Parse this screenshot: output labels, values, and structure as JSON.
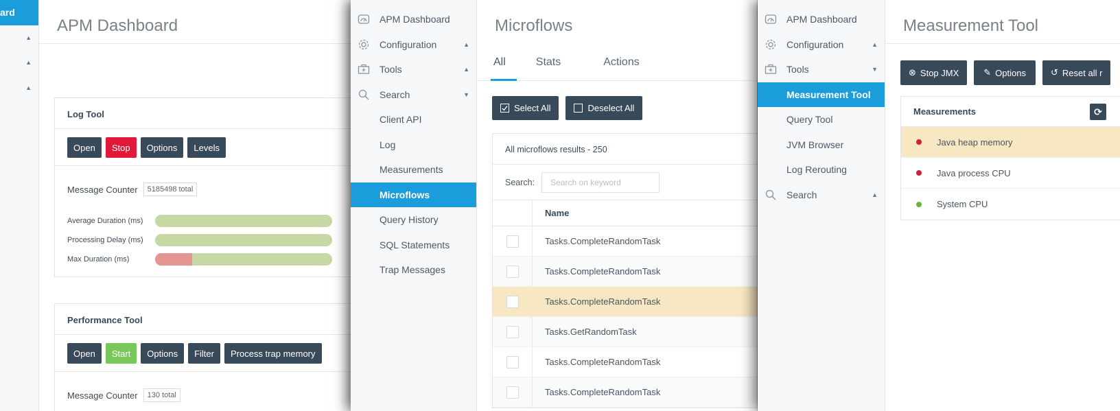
{
  "colors": {
    "accent": "#1b9ddb",
    "button_dark": "#38495a",
    "button_red": "#e1183a",
    "button_green": "#79c75a",
    "highlight_row": "#f8e7c3",
    "bar_green": "#c7d8a6",
    "bar_red": "#e49592",
    "dot_red": "#d0203c",
    "dot_green": "#6db33f"
  },
  "panel1": {
    "nav": [
      {
        "label": "ard",
        "active": true,
        "caret": ""
      },
      {
        "label": "",
        "active": false,
        "caret": "▲"
      },
      {
        "label": "",
        "active": false,
        "caret": "▲"
      },
      {
        "label": "",
        "active": false,
        "caret": "▲"
      }
    ],
    "title": "APM Dashboard",
    "log_tool": {
      "title": "Log Tool",
      "buttons": [
        "Open",
        "Stop",
        "Options",
        "Levels"
      ],
      "counter_label": "Message Counter",
      "counter_value": "5185498 total",
      "bars": [
        {
          "label": "Average Duration (ms)",
          "red_fraction": 0
        },
        {
          "label": "Processing Delay (ms)",
          "red_fraction": 0
        },
        {
          "label": "Max Duration (ms)",
          "red_fraction": 0.21
        }
      ]
    },
    "performance_tool": {
      "title": "Performance Tool",
      "buttons": [
        "Open",
        "Start",
        "Options",
        "Filter",
        "Process trap memory"
      ],
      "counter_label": "Message Counter",
      "counter_value": "130 total"
    }
  },
  "panel2": {
    "nav": [
      {
        "label": "APM Dashboard",
        "icon": "gauge-icon",
        "caret": ""
      },
      {
        "label": "Configuration",
        "icon": "gear-icon",
        "caret": "▲"
      },
      {
        "label": "Tools",
        "icon": "toolbox-icon",
        "caret": "▲"
      },
      {
        "label": "Search",
        "icon": "search-icon",
        "caret": "▼"
      },
      {
        "label": "Client API",
        "sub": true
      },
      {
        "label": "Log",
        "sub": true
      },
      {
        "label": "Measurements",
        "sub": true
      },
      {
        "label": "Microflows",
        "sub": true,
        "active": true
      },
      {
        "label": "Query History",
        "sub": true
      },
      {
        "label": "SQL Statements",
        "sub": true
      },
      {
        "label": "Trap Messages",
        "sub": true
      }
    ],
    "title": "Microflows",
    "tabs": [
      "All",
      "Stats",
      "Actions"
    ],
    "select_all": "Select All",
    "deselect_all": "Deselect All",
    "results_label": "All microflows results",
    "results_count": "- 250",
    "search_label": "Search:",
    "search_placeholder": "Search on keyword",
    "column_name": "Name",
    "rows": [
      "Tasks.CompleteRandomTask",
      "Tasks.CompleteRandomTask",
      "Tasks.CompleteRandomTask",
      "Tasks.GetRandomTask",
      "Tasks.CompleteRandomTask",
      "Tasks.CompleteRandomTask"
    ]
  },
  "panel3": {
    "nav": [
      {
        "label": "APM Dashboard",
        "icon": "gauge-icon",
        "caret": ""
      },
      {
        "label": "Configuration",
        "icon": "gear-icon",
        "caret": "▲"
      },
      {
        "label": "Tools",
        "icon": "toolbox-icon",
        "caret": "▼"
      },
      {
        "label": "Measurement Tool",
        "sub": true,
        "active": true
      },
      {
        "label": "Query Tool",
        "sub": true
      },
      {
        "label": "JVM Browser",
        "sub": true
      },
      {
        "label": "Log Rerouting",
        "sub": true
      },
      {
        "label": "Search",
        "icon": "search-icon",
        "caret": "▲"
      }
    ],
    "title": "Measurement Tool",
    "buttons": [
      "Stop JMX",
      "Options",
      "Reset all r"
    ],
    "measurements_title": "Measurements",
    "measurements": [
      {
        "label": "Java heap memory",
        "status": "red"
      },
      {
        "label": "Java process CPU",
        "status": "red"
      },
      {
        "label": "System CPU",
        "status": "green"
      }
    ]
  }
}
